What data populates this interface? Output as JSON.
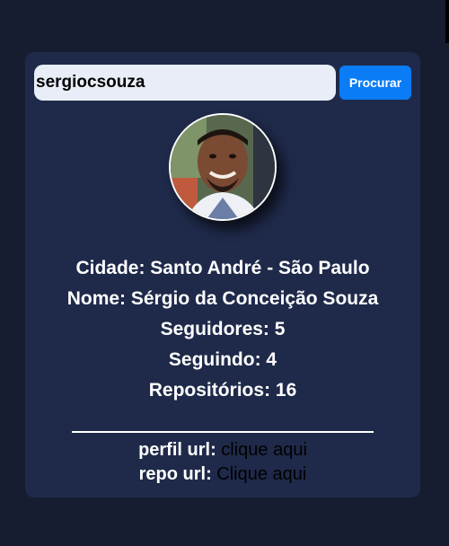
{
  "search": {
    "value": "sergiocsouza",
    "button_label": "Procurar"
  },
  "profile": {
    "city": "Cidade: Santo André - São Paulo",
    "name": "Nome: Sérgio da Conceição Souza",
    "followers": "Seguidores: 5",
    "following": "Seguindo: 4",
    "repos": "Repositórios: 16"
  },
  "links": {
    "profile_label": "perfil url:",
    "profile_link": "clique aqui",
    "repo_label": "repo url:",
    "repo_link": "Clique aqui"
  },
  "colors": {
    "page_background": "#161d30",
    "card_background": "#1f2a4a",
    "button_background": "#0a7cf6",
    "input_background": "#e8edf7"
  }
}
